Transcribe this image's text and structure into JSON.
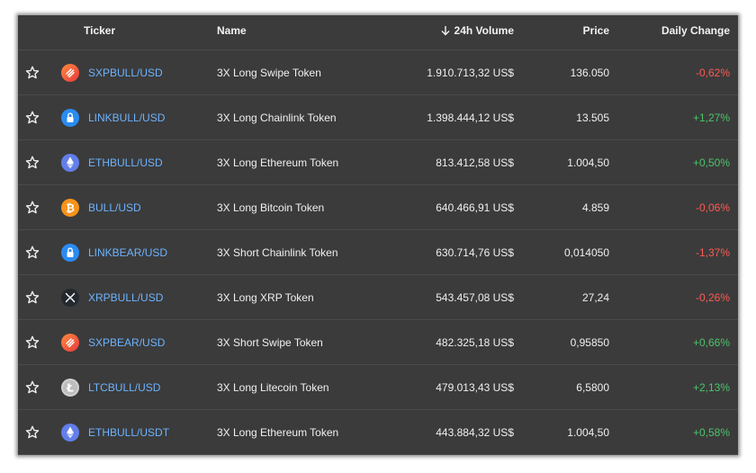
{
  "header": {
    "ticker": "Ticker",
    "name": "Name",
    "volume": "24h Volume",
    "price": "Price",
    "change": "Daily Change"
  },
  "colors": {
    "positive": "#4cc46a",
    "negative": "#ff5a52",
    "ticker_link": "#6db3ff"
  },
  "rows": [
    {
      "icon": "swipe-icon",
      "ticker": "SXPBULL/USD",
      "name": "3X Long Swipe Token",
      "volume": "1.910.713,32 US$",
      "price": "136.050",
      "change": "-0,62%",
      "direction": "neg"
    },
    {
      "icon": "chainlink-icon",
      "ticker": "LINKBULL/USD",
      "name": "3X Long Chainlink Token",
      "volume": "1.398.444,12 US$",
      "price": "13.505",
      "change": "+1,27%",
      "direction": "pos"
    },
    {
      "icon": "ethereum-icon",
      "ticker": "ETHBULL/USD",
      "name": "3X Long Ethereum Token",
      "volume": "813.412,58 US$",
      "price": "1.004,50",
      "change": "+0,50%",
      "direction": "pos"
    },
    {
      "icon": "bitcoin-icon",
      "ticker": "BULL/USD",
      "name": "3X Long Bitcoin Token",
      "volume": "640.466,91 US$",
      "price": "4.859",
      "change": "-0,06%",
      "direction": "neg"
    },
    {
      "icon": "chainlink-icon",
      "ticker": "LINKBEAR/USD",
      "name": "3X Short Chainlink Token",
      "volume": "630.714,76 US$",
      "price": "0,014050",
      "change": "-1,37%",
      "direction": "neg"
    },
    {
      "icon": "xrp-icon",
      "ticker": "XRPBULL/USD",
      "name": "3X Long XRP Token",
      "volume": "543.457,08 US$",
      "price": "27,24",
      "change": "-0,26%",
      "direction": "neg"
    },
    {
      "icon": "swipe-icon",
      "ticker": "SXPBEAR/USD",
      "name": "3X Short Swipe Token",
      "volume": "482.325,18 US$",
      "price": "0,95850",
      "change": "+0,66%",
      "direction": "pos"
    },
    {
      "icon": "litecoin-icon",
      "ticker": "LTCBULL/USD",
      "name": "3X Long Litecoin Token",
      "volume": "479.013,43 US$",
      "price": "6,5800",
      "change": "+2,13%",
      "direction": "pos"
    },
    {
      "icon": "ethereum-icon",
      "ticker": "ETHBULL/USDT",
      "name": "3X Long Ethereum Token",
      "volume": "443.884,32 US$",
      "price": "1.004,50",
      "change": "+0,58%",
      "direction": "pos"
    }
  ]
}
